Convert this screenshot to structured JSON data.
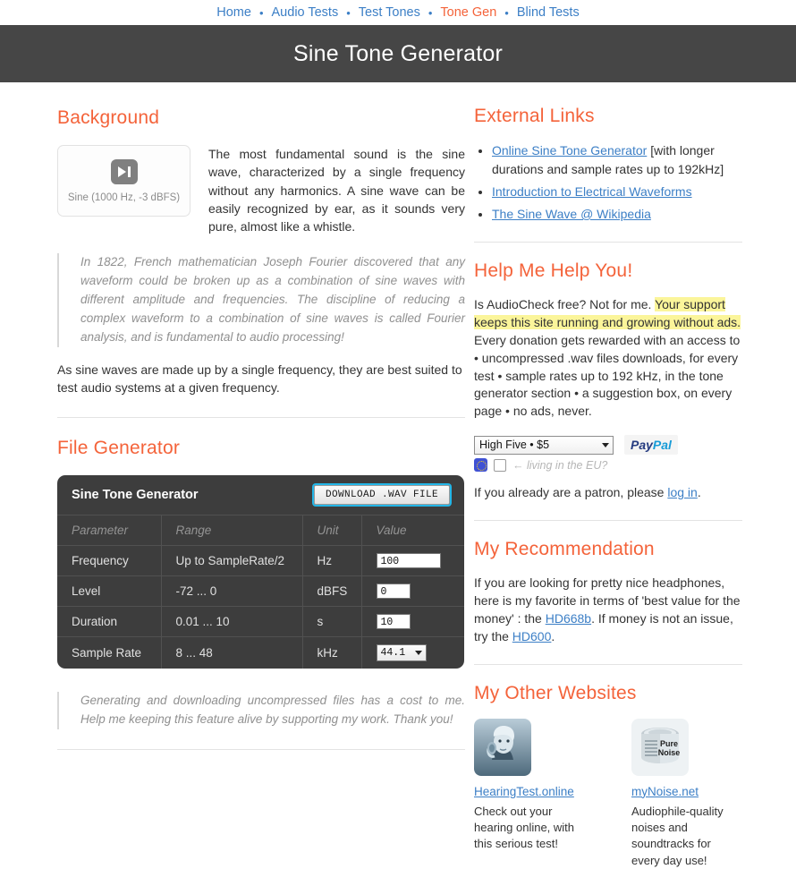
{
  "nav": {
    "items": [
      {
        "label": "Home",
        "current": false
      },
      {
        "label": "Audio Tests",
        "current": false
      },
      {
        "label": "Test Tones",
        "current": false
      },
      {
        "label": "Tone Gen",
        "current": true
      },
      {
        "label": "Blind Tests",
        "current": false
      }
    ],
    "separator": "•"
  },
  "banner": {
    "title": "Sine Tone Generator"
  },
  "colors": {
    "accent_orange": "#f4633a",
    "link_blue": "#3c7fc6",
    "banner_bg": "#464646",
    "table_bg": "#3d3d3d",
    "highlight": "#fbf59a",
    "focus_ring": "#22b6e8"
  },
  "background": {
    "heading": "Background",
    "player_label": "Sine (1000 Hz, -3 dBFS)",
    "paragraph": "The most fundamental sound is the sine wave, characterized by a single frequency without any harmonics. A sine wave can be easily recognized by ear, as it sounds very pure, almost like a whistle.",
    "quote": "In 1822, French mathematician Joseph Fourier discovered that any waveform could be broken up as a combination of sine waves with different amplitude and frequencies. The discipline of reducing a complex waveform to a combination of sine waves is called Fourier analysis, and is fundamental to audio processing!",
    "closing": "As sine waves are made up by a single frequency, they are best suited to test audio systems at a given frequency."
  },
  "file_generator": {
    "heading": "File Generator",
    "panel_title": "Sine Tone Generator",
    "download_label": "DOWNLOAD .WAV FILE",
    "columns": [
      "Parameter",
      "Range",
      "Unit",
      "Value"
    ],
    "rows": [
      {
        "parameter": "Frequency",
        "range": "Up to SampleRate/2",
        "unit": "Hz",
        "value": "100",
        "control": "input"
      },
      {
        "parameter": "Level",
        "range": "-72 ... 0",
        "unit": "dBFS",
        "value": "0",
        "control": "input"
      },
      {
        "parameter": "Duration",
        "range": "0.01 ... 10",
        "unit": "s",
        "value": "10",
        "control": "input"
      },
      {
        "parameter": "Sample Rate",
        "range": "8 ... 48",
        "unit": "kHz",
        "value": "44.1",
        "control": "select"
      }
    ],
    "footnote": "Generating and downloading uncompressed files has a cost to me. Help me keeping this feature alive by supporting my work. Thank you!"
  },
  "external_links": {
    "heading": "External Links",
    "items": [
      {
        "link": "Online Sine Tone Generator",
        "trailing": " [with longer durations and sample rates up to 192kHz]"
      },
      {
        "link": "Introduction to Electrical Waveforms",
        "trailing": ""
      },
      {
        "link": "The Sine Wave @ Wikipedia",
        "trailing": ""
      }
    ]
  },
  "help": {
    "heading": "Help Me Help You!",
    "text_before": "Is AudioCheck free? Not for me. ",
    "highlight": "Your support keeps this site running and growing without ads.",
    "text_after": " Every donation gets rewarded with an access to • uncompressed .wav files downloads, for every test • sample rates up to 192 kHz, in the tone generator section • a suggestion box, on every page • no ads, never.",
    "donation_option": "High Five • $5",
    "paypal_pay": "Pay",
    "paypal_pal": "Pal",
    "eu_question": "← living in the EU?",
    "patron_before": "If you already are a patron, please ",
    "patron_link": "log in",
    "patron_after": "."
  },
  "recommendation": {
    "heading": "My Recommendation",
    "text_before": "If you are looking for pretty nice headphones, here is my favorite in terms of 'best value for the money' : the ",
    "link1": "HD668b",
    "text_middle": ". If money is not an issue, try the ",
    "link2": "HD600",
    "text_after": "."
  },
  "other_websites": {
    "heading": "My Other Websites",
    "sites": [
      {
        "name": "HearingTest.online",
        "description": "Check out your hearing online, with this serious test!",
        "thumb": "einstein-headphones-thumbnail"
      },
      {
        "name": "myNoise.net",
        "description": "Audiophile-quality noises and soundtracks for every day use!",
        "thumb": "pure-noise-can-thumbnail",
        "can_label_line1": "Pure",
        "can_label_line2": "Noise"
      }
    ]
  }
}
